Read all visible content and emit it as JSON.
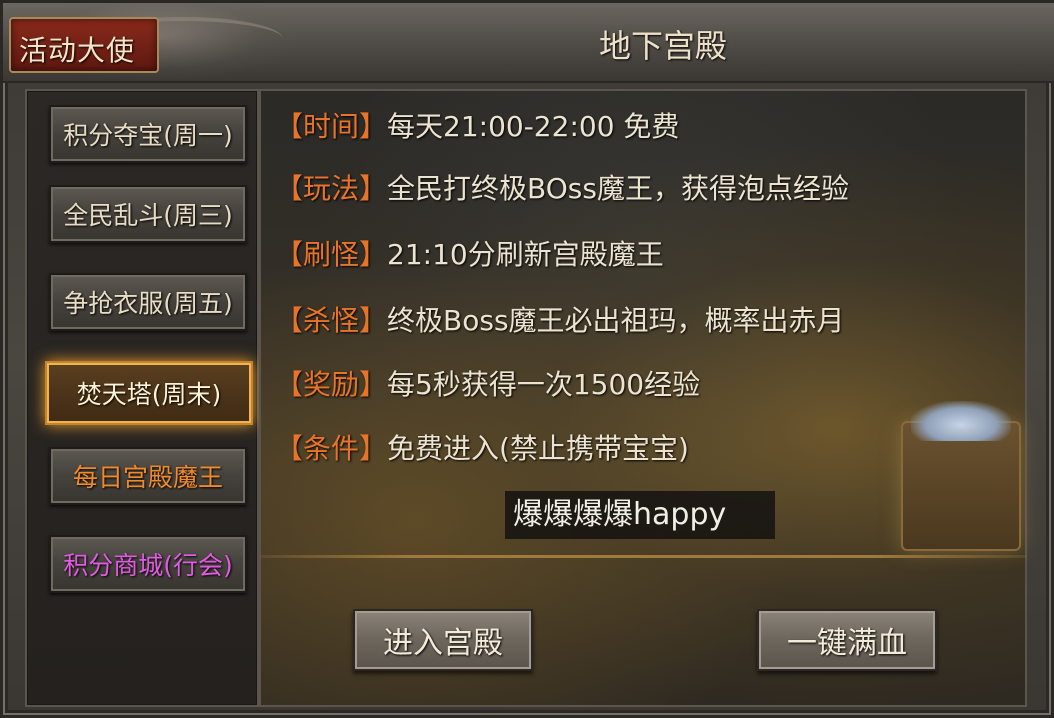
{
  "window": {
    "badge": "活动大使",
    "title": "地下宫殿"
  },
  "sidebar": {
    "items": [
      {
        "label": "积分夺宝(周一)",
        "state": "normal"
      },
      {
        "label": "全民乱斗(周三)",
        "state": "normal"
      },
      {
        "label": "争抢衣服(周五)",
        "state": "normal"
      },
      {
        "label": "焚天塔(周末)",
        "state": "selected"
      },
      {
        "label": "每日宫殿魔王",
        "state": "normal",
        "color": "#f08a2a"
      },
      {
        "label": "积分商城(行会)",
        "state": "normal",
        "color": "#e05be0"
      }
    ]
  },
  "info": {
    "rows": [
      {
        "tag": "【时间】",
        "text": "每天21:00-22:00 免费"
      },
      {
        "tag": "【玩法】",
        "text": "全民打终极BOss魔王，获得泡点经验"
      },
      {
        "tag": "【刷怪】",
        "text": "21:10分刷新宫殿魔王"
      },
      {
        "tag": "【杀怪】",
        "text": "终极Boss魔王必出祖玛，概率出赤月"
      },
      {
        "tag": "【奖励】",
        "text": "每5秒获得一次1500经验"
      },
      {
        "tag": "【条件】",
        "text": "免费进入(禁止携带宝宝)"
      }
    ],
    "chat_bubble": "爆爆爆爆happy"
  },
  "actions": {
    "enter_label": "进入宫殿",
    "heal_label": "一键满血"
  },
  "colors": {
    "tag": "#e8742a",
    "text": "#ece3d0",
    "selected_border": "#f0b450"
  }
}
